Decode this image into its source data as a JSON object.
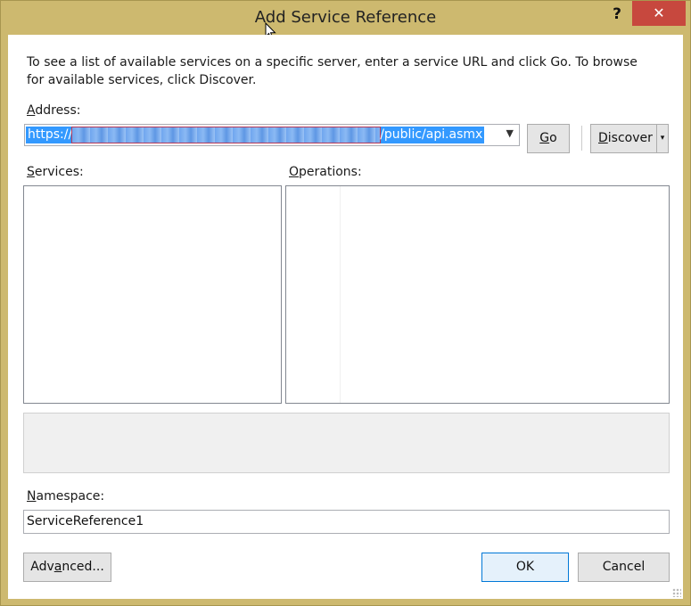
{
  "window": {
    "title": "Add Service Reference",
    "help_label": "?",
    "close_label": "✕"
  },
  "intro_text": "To see a list of available services on a specific server, enter a service URL and click Go. To browse for available services, click Discover.",
  "address": {
    "label_accel": "A",
    "label_rest": "ddress:",
    "value_prefix": "https://",
    "value_suffix": "/public/api.asmx"
  },
  "buttons": {
    "go_accel": "G",
    "go_rest": "o",
    "discover_accel": "D",
    "discover_rest": "iscover",
    "discover_arrow": "▾",
    "advanced_pre": "Adv",
    "advanced_accel": "a",
    "advanced_post": "nced...",
    "ok": "OK",
    "cancel": "Cancel"
  },
  "services_label": {
    "accel": "S",
    "rest": "ervices:"
  },
  "operations_label": {
    "accel": "O",
    "rest": "perations:"
  },
  "namespace": {
    "label_accel": "N",
    "label_rest": "amespace:",
    "value": "ServiceReference1"
  },
  "colors": {
    "frame": "#cdb96f",
    "close_button": "#c7483e",
    "selection": "#3399ff",
    "default_button_border": "#0078d7"
  }
}
